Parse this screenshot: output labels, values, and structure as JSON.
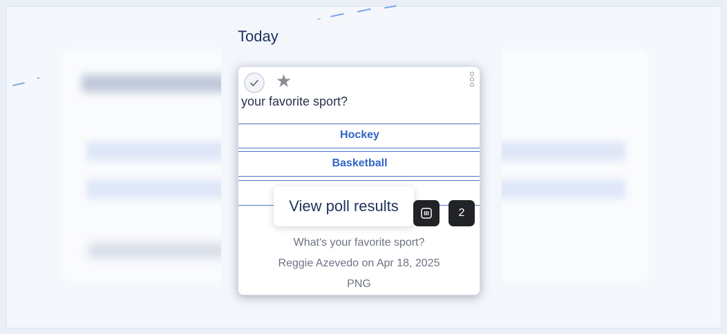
{
  "section": {
    "heading": "Today"
  },
  "poll": {
    "question_visible": "your favorite sport?",
    "options": [
      {
        "label": "Hockey"
      },
      {
        "label": "Basketball"
      }
    ]
  },
  "tooltip": {
    "text": "View poll results"
  },
  "actions": {
    "results_icon": "poll-results-icon",
    "count": "2"
  },
  "attachment": {
    "title": "What's your favorite sport?",
    "byline": "Reggie Azevedo on Apr 18, 2025",
    "type": "PNG"
  },
  "icons": {
    "check": "check-icon",
    "star": "star-icon",
    "more": "more-vertical-icon"
  },
  "colors": {
    "accent": "#2f65c6",
    "heading": "#1c2f5e",
    "dark_button": "#222326"
  }
}
